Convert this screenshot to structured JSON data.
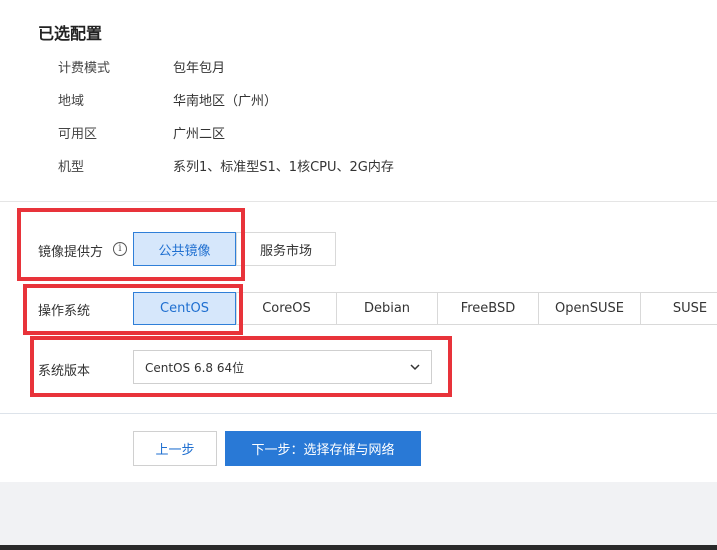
{
  "selected_config": {
    "title": "已选配置",
    "rows": [
      {
        "label": "计费模式",
        "value": "包年包月"
      },
      {
        "label": "地域",
        "value": "华南地区（广州）"
      },
      {
        "label": "可用区",
        "value": "广州二区"
      },
      {
        "label": "机型",
        "value": "系列1、标准型S1、1核CPU、2G内存"
      }
    ]
  },
  "image_provider": {
    "label": "镜像提供方",
    "info_icon": "info-icon",
    "options": [
      "公共镜像",
      "服务市场"
    ],
    "selected": "公共镜像"
  },
  "os": {
    "label": "操作系统",
    "options": [
      "CentOS",
      "CoreOS",
      "Debian",
      "FreeBSD",
      "OpenSUSE",
      "SUSE"
    ],
    "selected": "CentOS"
  },
  "os_version": {
    "label": "系统版本",
    "value": "CentOS 6.8 64位",
    "icon": "chevron-down-icon"
  },
  "footer": {
    "prev_label": "上一步",
    "next_label": "下一步：选择存储与网络"
  },
  "colors": {
    "accent": "#2979d6",
    "active_bg": "#d6e7fb",
    "highlight_box": "#e8333a"
  }
}
